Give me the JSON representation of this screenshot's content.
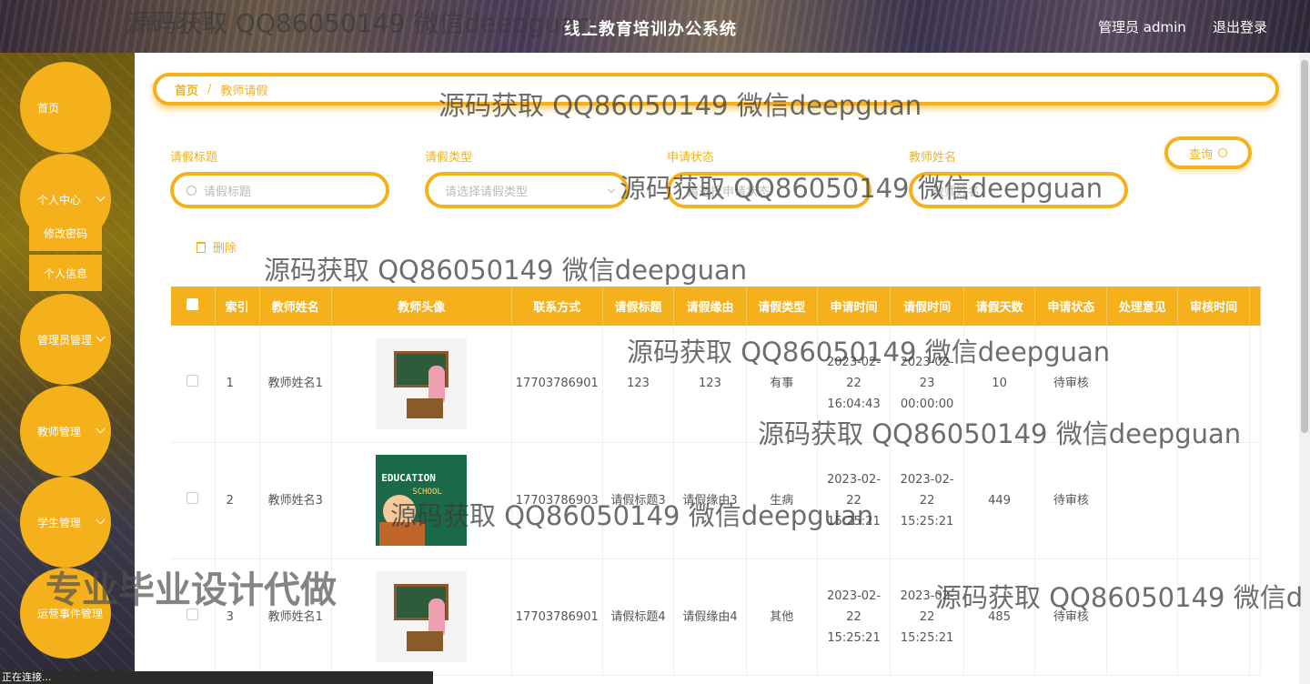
{
  "header": {
    "title": "线上教育培训办公系统",
    "user": "管理员 admin",
    "logout": "退出登录"
  },
  "sidebar": {
    "home": "首页",
    "personal_center": "个人中心",
    "change_password": "修改密码",
    "personal_info": "个人信息",
    "admin_mgmt": "管理员管理",
    "teacher_mgmt": "教师管理",
    "student_mgmt": "学生管理",
    "ops_event_mgmt": "运营事件管理"
  },
  "breadcrumb": {
    "home": "首页",
    "separator": "/",
    "current": "教师请假"
  },
  "filters": {
    "title_label": "请假标题",
    "title_placeholder": "请假标题",
    "type_label": "请假类型",
    "type_placeholder": "请选择请假类型",
    "status_label": "申请状态",
    "status_placeholder": "请选择申请状态",
    "teacher_label": "教师姓名",
    "teacher_placeholder": "教师姓名",
    "query": "查询"
  },
  "actions": {
    "delete": "删除"
  },
  "table": {
    "columns": [
      "索引",
      "教师姓名",
      "教师头像",
      "联系方式",
      "请假标题",
      "请假缘由",
      "请假类型",
      "申请时间",
      "请假时间",
      "请假天数",
      "申请状态",
      "处理意见",
      "审核时间"
    ],
    "rows": [
      {
        "index": "1",
        "name": "教师姓名1",
        "avatar": "teacher-blackboard",
        "phone": "17703786901",
        "title": "123",
        "reason": "123",
        "type": "有事",
        "apply_time": "2023-02-22 16:04:43",
        "leave_time": "2023-02-23 00:00:00",
        "days": "10",
        "status": "待审核",
        "opinion": "",
        "review_time": ""
      },
      {
        "index": "2",
        "name": "教师姓名3",
        "avatar": "education-poster",
        "phone": "17703786903",
        "title": "请假标题3",
        "reason": "请假缘由3",
        "type": "生病",
        "apply_time": "2023-02-22 15:25:21",
        "leave_time": "2023-02-22 15:25:21",
        "days": "449",
        "status": "待审核",
        "opinion": "",
        "review_time": ""
      },
      {
        "index": "3",
        "name": "教师姓名1",
        "avatar": "teacher-blackboard",
        "phone": "17703786901",
        "title": "请假标题4",
        "reason": "请假缘由4",
        "type": "其他",
        "apply_time": "2023-02-22 15:25:21",
        "leave_time": "2023-02-22 15:25:21",
        "days": "485",
        "status": "待审核",
        "opinion": "",
        "review_time": ""
      }
    ]
  },
  "avatar_text": {
    "education": "EDUCATION",
    "school": "SCHOOL"
  },
  "watermarks": {
    "contact": "源码获取 QQ86050149 微信deepguan",
    "contact_cut": "源码获取 QQ86050149 微信d",
    "banner": "专业毕业设计代做"
  },
  "status_bar": "正在连接..."
}
